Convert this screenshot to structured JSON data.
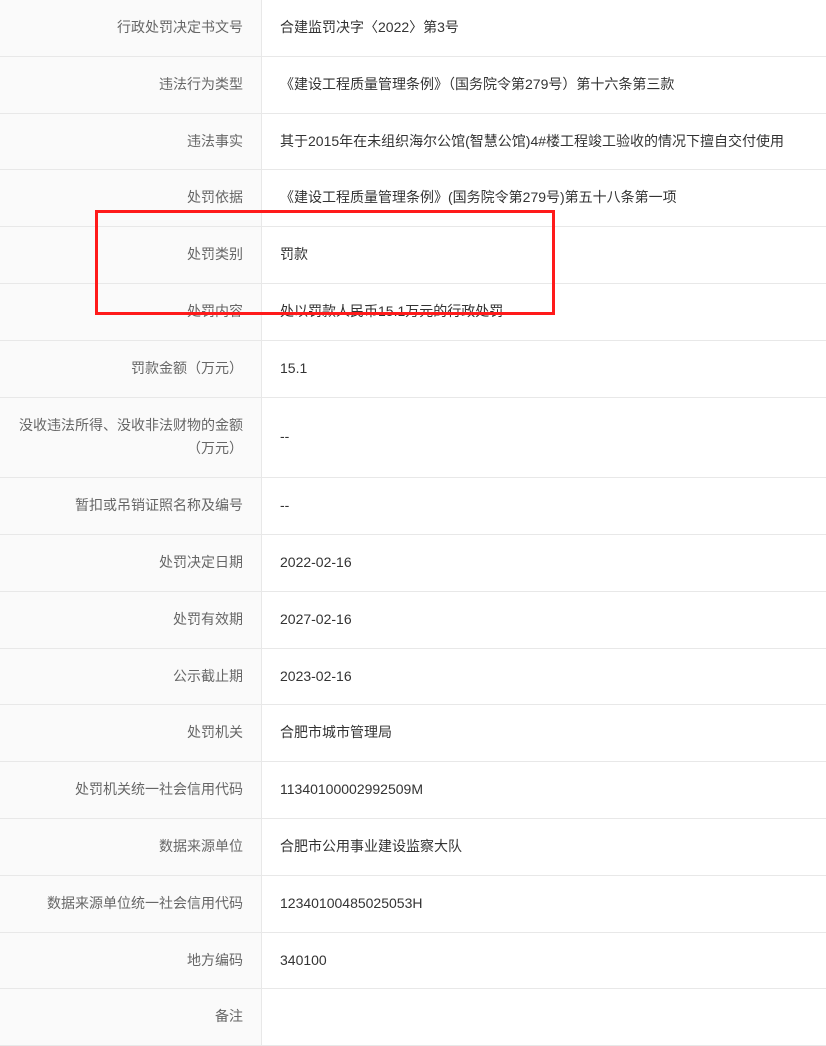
{
  "rows": [
    {
      "label": "行政处罚决定书文号",
      "value": "合建监罚决字〈2022〉第3号"
    },
    {
      "label": "违法行为类型",
      "value": "《建设工程质量管理条例》（国务院令第279号）第十六条第三款"
    },
    {
      "label": "违法事实",
      "value": "其于2015年在未组织海尔公馆(智慧公馆)4#楼工程竣工验收的情况下擅自交付使用"
    },
    {
      "label": "处罚依据",
      "value": "《建设工程质量管理条例》(国务院令第279号)第五十八条第一项"
    },
    {
      "label": "处罚类别",
      "value": "罚款"
    },
    {
      "label": "处罚内容",
      "value": "处以罚款人民币15.1万元的行政处罚"
    },
    {
      "label": "罚款金额（万元）",
      "value": "15.1"
    },
    {
      "label": "没收违法所得、没收非法财物的金额（万元）",
      "value": "--",
      "tall": true
    },
    {
      "label": "暂扣或吊销证照名称及编号",
      "value": "--"
    },
    {
      "label": "处罚决定日期",
      "value": "2022-02-16"
    },
    {
      "label": "处罚有效期",
      "value": "2027-02-16"
    },
    {
      "label": "公示截止期",
      "value": "2023-02-16"
    },
    {
      "label": "处罚机关",
      "value": "合肥市城市管理局"
    },
    {
      "label": "处罚机关统一社会信用代码",
      "value": "11340100002992509M"
    },
    {
      "label": "数据来源单位",
      "value": "合肥市公用事业建设监察大队"
    },
    {
      "label": "数据来源单位统一社会信用代码",
      "value": "12340100485025053H"
    },
    {
      "label": "地方编码",
      "value": "340100"
    },
    {
      "label": "备注",
      "value": ""
    }
  ]
}
